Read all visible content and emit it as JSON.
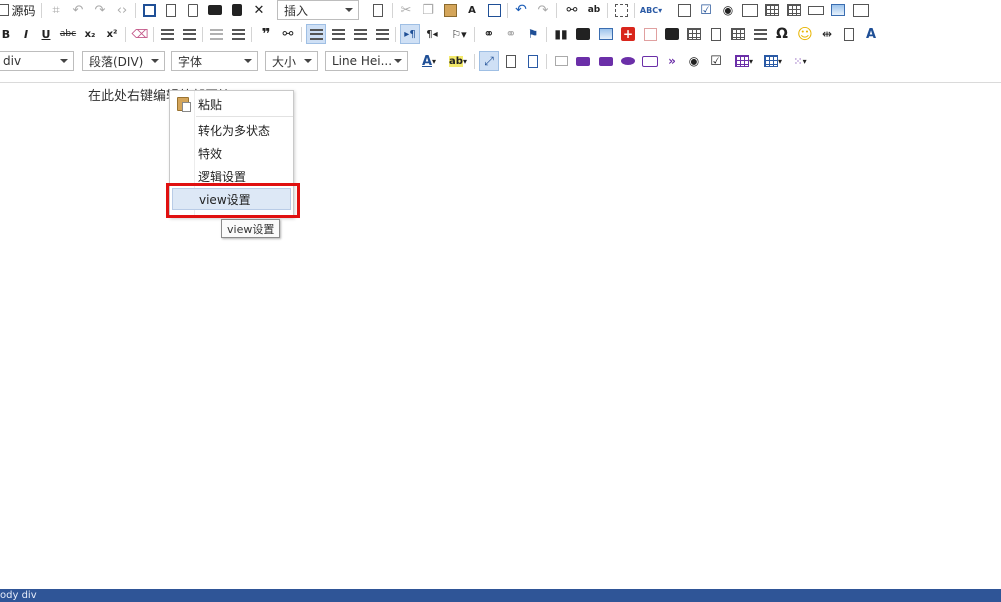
{
  "toolbar": {
    "row1": {
      "source_label": "源码",
      "insert_combo": "插入"
    },
    "row2": {
      "bold": "B",
      "italic": "I",
      "underline": "U",
      "strike": "abc",
      "subscript": "x₂",
      "superscript": "x²",
      "omega": "Ω"
    },
    "row3": {
      "element_combo": "div",
      "paragraph_combo": "段落(DIV)",
      "font_combo": "字体",
      "size_combo": "大小",
      "lineheight_combo": "Line Hei..."
    }
  },
  "editor": {
    "text": "在此处右键编辑外部区块(view)"
  },
  "context_menu": {
    "items": [
      {
        "label": "粘贴"
      },
      {
        "label": "转化为多状态"
      },
      {
        "label": "特效"
      },
      {
        "label": "逻辑设置"
      },
      {
        "label": "view设置"
      }
    ]
  },
  "tooltip": "view设置",
  "statusbar": {
    "text": "ody   div"
  },
  "colors": {
    "statusbar_bg": "#2f5597",
    "highlight_bg": "#dde8f6",
    "annotation_red": "#e01010",
    "active_button": "#cfe0f5"
  }
}
